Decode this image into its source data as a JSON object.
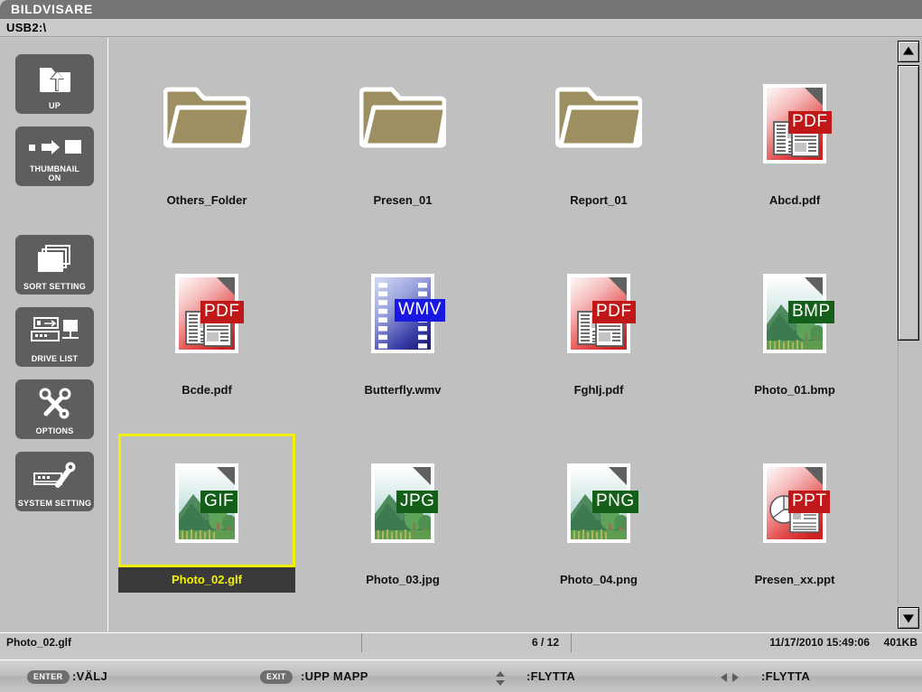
{
  "window": {
    "title": "BILDVISARE",
    "path": "USB2:\\"
  },
  "sidebar": {
    "buttons": [
      {
        "label": "UP",
        "icon": "folder-up-icon"
      },
      {
        "label": "THUMBNAIL\nON",
        "icon": "thumbnail-toggle-icon"
      },
      {
        "label": "SORT SETTING",
        "icon": "stacked-pages-icon"
      },
      {
        "label": "DRIVE LIST",
        "icon": "drive-list-icon"
      },
      {
        "label": "OPTIONS",
        "icon": "tools-icon"
      },
      {
        "label": "SYSTEM SETTING",
        "icon": "system-setting-icon"
      }
    ]
  },
  "files": [
    {
      "name": "Others_Folder",
      "type": "folder",
      "badge": "",
      "selected": false
    },
    {
      "name": "Presen_01",
      "type": "folder",
      "badge": "",
      "selected": false
    },
    {
      "name": "Report_01",
      "type": "folder",
      "badge": "",
      "selected": false
    },
    {
      "name": "Abcd.pdf",
      "type": "pdf",
      "badge": "PDF",
      "selected": false
    },
    {
      "name": "Bcde.pdf",
      "type": "pdf",
      "badge": "PDF",
      "selected": false
    },
    {
      "name": "Butterfly.wmv",
      "type": "wmv",
      "badge": "WMV",
      "selected": false
    },
    {
      "name": "FghIj.pdf",
      "type": "pdf",
      "badge": "PDF",
      "selected": false
    },
    {
      "name": "Photo_01.bmp",
      "type": "image",
      "badge": "BMP",
      "selected": false
    },
    {
      "name": "Photo_02.glf",
      "type": "image",
      "badge": "GIF",
      "selected": true
    },
    {
      "name": "Photo_03.jpg",
      "type": "image",
      "badge": "JPG",
      "selected": false
    },
    {
      "name": "Photo_04.png",
      "type": "image",
      "badge": "PNG",
      "selected": false
    },
    {
      "name": "Presen_xx.ppt",
      "type": "ppt",
      "badge": "PPT",
      "selected": false
    }
  ],
  "status": {
    "filename": "Photo_02.glf",
    "counter": "6 / 12",
    "datetime": "11/17/2010  15:49:06",
    "filesize": "401KB"
  },
  "hints": [
    {
      "key": "ENTER",
      "label": ":VÄLJ"
    },
    {
      "key": "EXIT",
      "label": ":UPP MAPP"
    },
    {
      "key": "updown",
      "label": ":FLYTTA"
    },
    {
      "key": "leftright",
      "label": ":FLYTTA"
    }
  ],
  "colors": {
    "titlebar": "#757575",
    "folder": "#9d8f62",
    "selection": "#f2f200",
    "badge_red": "#c01818",
    "badge_green": "#14601a",
    "badge_blue": "#1818e0"
  },
  "scrollbar": {
    "up_arrow": "▲",
    "down_arrow": "▼"
  }
}
